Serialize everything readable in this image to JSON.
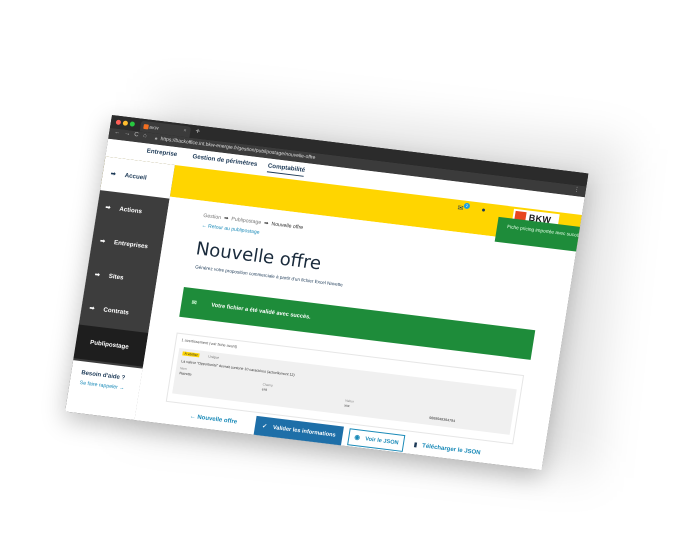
{
  "browser": {
    "tab_title": "BKW",
    "tab_close": "×",
    "new_tab": "+",
    "back": "←",
    "forward": "→",
    "reload": "C",
    "home": "⌂",
    "url": "https://backoffice.int.bkw-energie.fr/gestion/publipostage/nouvelle-offre",
    "dot_colors": [
      "#ff5f57",
      "#febc2e",
      "#28c840"
    ]
  },
  "topnav": {
    "items": [
      "Entreprise",
      "Gestion de périmètres",
      "Comptabilité"
    ]
  },
  "header": {
    "notif_count": "2",
    "brand": "BKW",
    "brand_color": "#e8461e",
    "band_color": "#ffd500"
  },
  "sidebar": {
    "items": [
      {
        "label": "Accueil",
        "arrow": "➡"
      },
      {
        "label": "Actions",
        "arrow": "➡"
      },
      {
        "label": "Entreprises",
        "arrow": "➡"
      },
      {
        "label": "Sites",
        "arrow": "➡"
      },
      {
        "label": "Contrats",
        "arrow": "➡"
      },
      {
        "label": "Publipostage",
        "arrow": ""
      }
    ],
    "help_title": "Besoin d'aide ?",
    "help_link": "Se faire rappeler  →"
  },
  "toast": {
    "message": "Fiche pricing importée avec succès",
    "close": "→"
  },
  "breadcrumb": {
    "items": [
      "Gestion",
      "Publipostage",
      "Nouvelle offre"
    ],
    "sep": "➡"
  },
  "page": {
    "back_link": "← Retour au publipostage",
    "title": "Nouvelle offre",
    "subtitle": "Générez votre proposition commerciale à partir d'un fichier Excel Navette"
  },
  "success": {
    "icon": "✉",
    "message": "Votre fichier a été validé avec succès."
  },
  "filecard": {
    "header": "1 avertissement (voir fiche avant)",
    "pill": "À vérifier",
    "tag": "Unique",
    "warning": "La valeur \"Opportunité\" devrait contenir 10 caractères (actuellement 12)",
    "fields": [
      {
        "label": "Nom",
        "value": "Navette"
      },
      {
        "label": "Champ",
        "value": "ent"
      },
      {
        "label": "Valeur",
        "value": "xxx"
      },
      {
        "label": "",
        "value": "9868948394784"
      }
    ]
  },
  "actions": {
    "back": "←   Nouvelle offre",
    "validate": "Valider les informations",
    "validate_icon": "✓",
    "json": "Voir le JSON",
    "json_icon": "◉",
    "download": "Télécharger le JSON",
    "download_icon": "▮"
  },
  "colors": {
    "accent": "#1a8ab8",
    "primary_button": "#1e6fa8",
    "success": "#1e8c3a",
    "navy": "#1d3a57",
    "sidebar": "#3d3d3d"
  }
}
